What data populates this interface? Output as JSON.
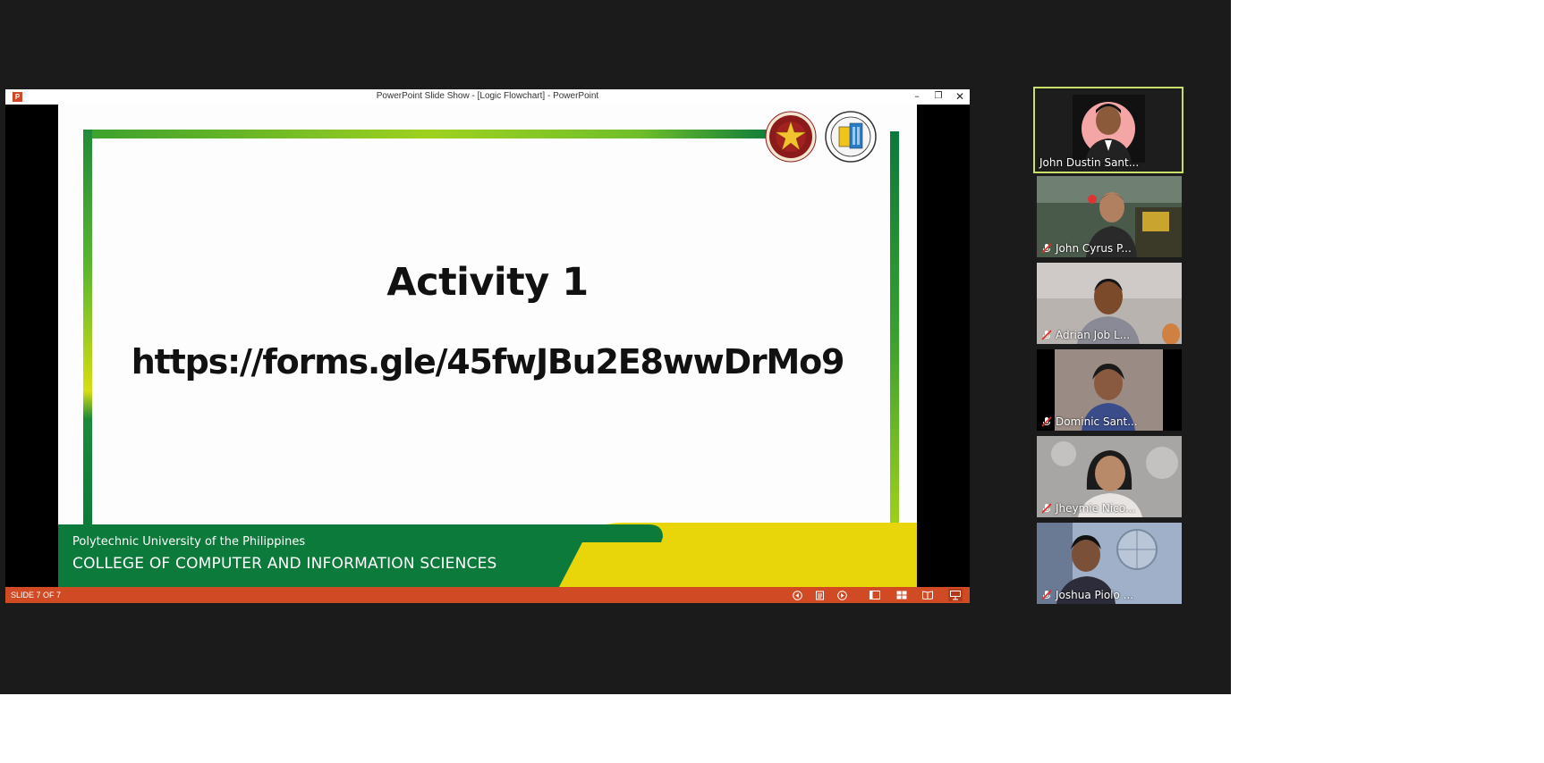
{
  "powerpoint": {
    "window_title": "PowerPoint Slide Show - [Logic Flowchart] - PowerPoint",
    "logo_glyph": "P",
    "controls": {
      "minimize": "–",
      "maximize": "❐",
      "close": "✕"
    }
  },
  "slide": {
    "heading": "Activity 1",
    "url": "https://forms.gle/45fwJBu2E8wwDrMo9",
    "footer_university": "Polytechnic University of the Philippines",
    "footer_college": "COLLEGE OF COMPUTER AND INFORMATION SCIENCES",
    "colors": {
      "green": "#0b7a3a",
      "lime": "#6fbf2a",
      "yellow": "#e8d60a"
    }
  },
  "statusbar": {
    "slide_counter": "SLIDE 7 OF 7",
    "color": "#d04a24",
    "buttons": [
      "previous-icon",
      "notes-icon",
      "next-icon",
      "normal-view-icon",
      "slide-sorter-icon",
      "reading-view-icon",
      "slideshow-icon"
    ]
  },
  "participants": [
    {
      "name": "John Dustin Sant...",
      "muted": false,
      "active_speaker": true
    },
    {
      "name": "John Cyrus P...",
      "muted": true
    },
    {
      "name": "Adrian Job L...",
      "muted": true
    },
    {
      "name": "Dominic Sant...",
      "muted": true
    },
    {
      "name": "Jheymie Nico...",
      "muted": true
    },
    {
      "name": "Joshua Piolo ...",
      "muted": true
    }
  ],
  "accent_active_speaker": "#c8e06a"
}
